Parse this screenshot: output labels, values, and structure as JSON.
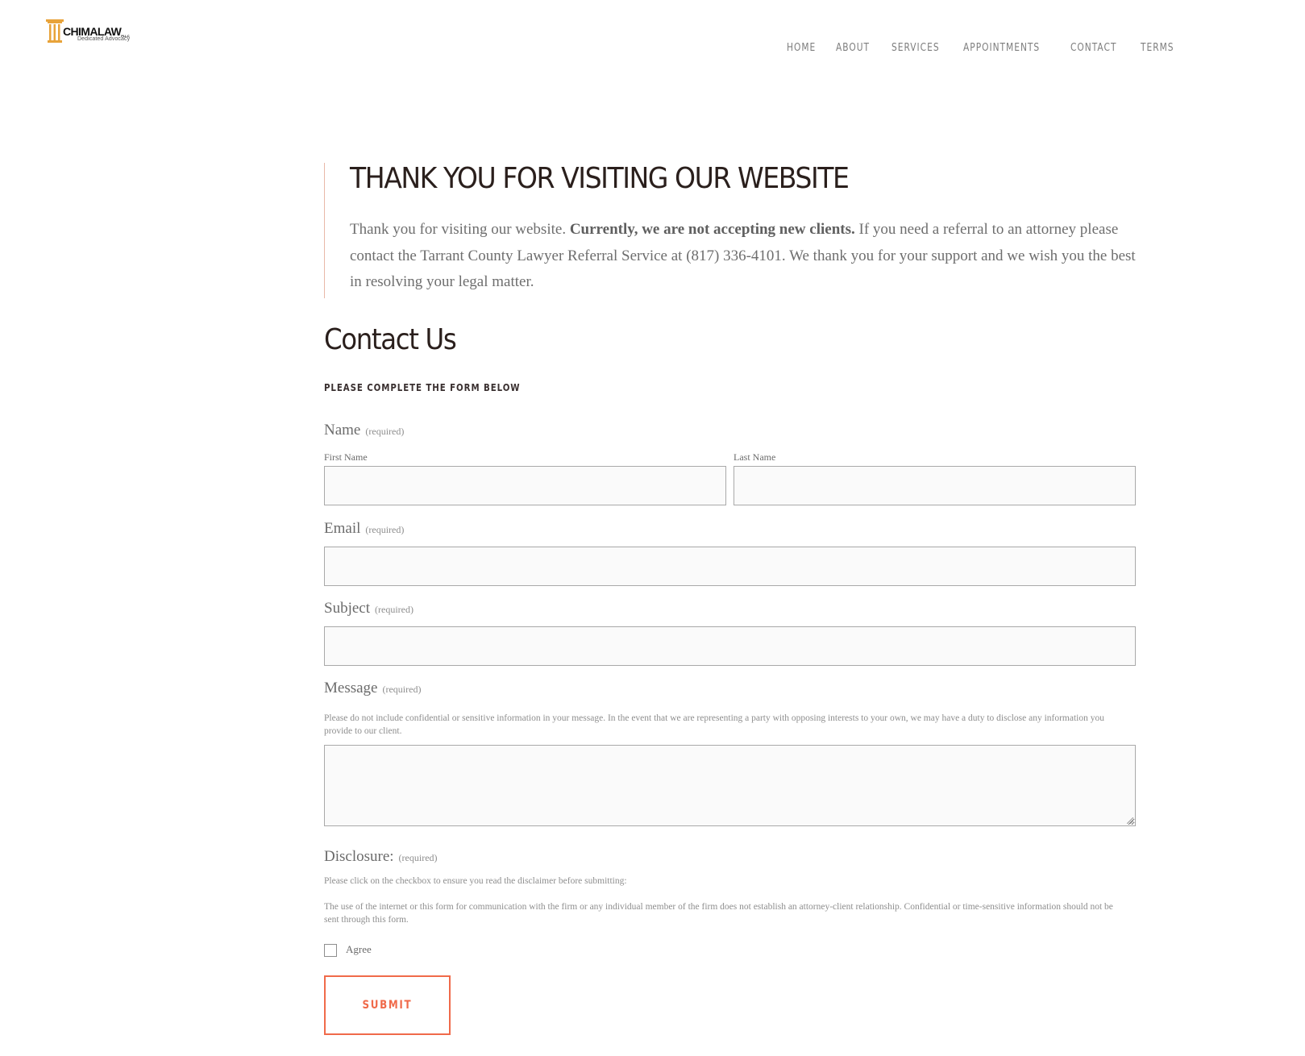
{
  "brand": {
    "name": "CHIMALAW",
    "suffix": "PLLC",
    "tagline": "Dedicated Advocacy",
    "accent_color": "#e8a33a"
  },
  "nav": {
    "items": [
      "HOME",
      "ABOUT",
      "SERVICES",
      "APPOINTMENTS",
      "CONTACT",
      "TERMS"
    ]
  },
  "notice": {
    "title": "THANK YOU FOR VISITING OUR WEBSITE",
    "text_before": "Thank you for visiting our website. ",
    "text_bold": "Currently, we are not accepting new clients.",
    "text_after": " If you need a referral to an attorney please contact the Tarrant County Lawyer Referral Service at (817) 336-4101. We thank you for your support and we wish you the best in resolving your legal matter."
  },
  "contact": {
    "title": "Contact Us",
    "intro": "PLEASE COMPLETE THE FORM BELOW"
  },
  "form": {
    "required_text": "(required)",
    "name": {
      "label": "Name",
      "first_label": "First Name",
      "first_value": "",
      "last_label": "Last Name",
      "last_value": ""
    },
    "email": {
      "label": "Email",
      "value": ""
    },
    "subject": {
      "label": "Subject",
      "value": ""
    },
    "message": {
      "label": "Message",
      "help": "Please do not include confidential or sensitive information in your message. In the event that we are representing a party with opposing interests to your own, we may have a duty to disclose any information you provide to our client.",
      "value": ""
    },
    "disclosure": {
      "label": "Disclosure:",
      "help1": "Please click on the checkbox to ensure you read the disclaimer before submitting:",
      "help2": "The use of the internet or this form for communication with the firm or any individual member of the firm does not establish an attorney-client relationship. Confidential or time-sensitive information should not be sent through this form.",
      "checkbox_label": "Agree",
      "checked": false
    },
    "submit_label": "SUBMIT",
    "submit_color": "#f06a4a"
  }
}
